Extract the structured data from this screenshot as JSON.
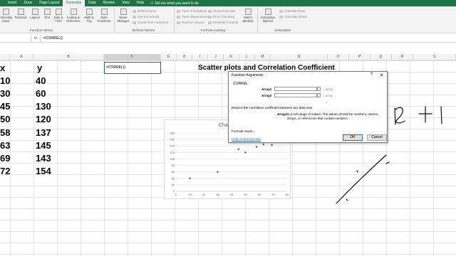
{
  "ribbon": {
    "tabs": [
      "Insert",
      "Draw",
      "Page Layout",
      "Formulas",
      "Data",
      "Review",
      "View",
      "Help"
    ],
    "active_tab": "Formulas",
    "tell_me": "Tell me what you want to do",
    "buttons": {
      "recently_used": "Recently Used",
      "financial": "Financial",
      "logical": "Logical",
      "text": "Text",
      "date_time": "Date & Time",
      "lookup_reference": "Lookup & Reference",
      "math_trig": "Math & Trig",
      "more_functions": "More Functions",
      "name_manager": "Name Manager",
      "define_name": "Define Name",
      "use_in_formula": "Use in Formula",
      "create_from_selection": "Create from Selection",
      "trace_precedents": "Trace Precedents",
      "trace_dependents": "Trace Dependents",
      "remove_arrows": "Remove Arrows",
      "show_formulas": "Show Formulas",
      "error_checking": "Error Checking",
      "evaluate_formula": "Evaluate Formula",
      "watch_window": "Watch Window",
      "calculation_options": "Calculation Options",
      "calculate_now": "Calculate Now",
      "calculate_sheet": "Calculate Sheet"
    },
    "groups": {
      "function_library": "Function Library",
      "defined_names": "Defined Names",
      "formula_auditing": "Formula Auditing",
      "calculation": "Calculation"
    }
  },
  "formula_bar": {
    "fx": "fx",
    "content": "=CORREL()"
  },
  "columns": [
    "A",
    "B",
    "C",
    "D",
    "E",
    "F",
    "G",
    "H",
    "I",
    "J",
    "K",
    "L",
    "M",
    "N",
    "O",
    "P",
    "Q",
    "R",
    "S"
  ],
  "selected_column": "F",
  "data": {
    "x_header": "x",
    "y_header": "y",
    "x_values": [
      "10",
      "30",
      "45",
      "50",
      "58",
      "63",
      "69",
      "72"
    ],
    "y_values": [
      "40",
      "60",
      "130",
      "120",
      "137",
      "145",
      "143",
      "154"
    ]
  },
  "active_cell": "=CORREL()",
  "sheet_title": "Scatter plots and Correlation Coefficient",
  "chart_data": {
    "type": "scatter",
    "title": "Chart",
    "x": [
      10,
      30,
      45,
      50,
      58,
      63,
      69
    ],
    "y": [
      40,
      60,
      130,
      120,
      137,
      145,
      143
    ],
    "xlim": [
      0,
      80
    ],
    "ylim": [
      0,
      180
    ],
    "x_ticks": [
      "0",
      "10",
      "20",
      "30",
      "40",
      "50",
      "60",
      "70",
      "80"
    ],
    "y_ticks": [
      "0",
      "20",
      "40",
      "60",
      "80",
      "100",
      "120",
      "140",
      "160",
      "180"
    ],
    "grid": true,
    "marker_color": "#4472c4"
  },
  "dialog": {
    "title": "Function Arguments",
    "help": "?",
    "close": "×",
    "function_name": "CORREL",
    "arg1_label": "Array1",
    "arg2_label": "Array2",
    "arg_result": "= array",
    "arg_equals": "=",
    "description": "Returns the correlation coefficient between two data sets.",
    "arg_name": "Array1",
    "arg_description": "is a cell range of values. The values should be numbers, names, arrays, or references that contain numbers.",
    "formula_result": "Formula result =",
    "help_link": "Help on this function",
    "ok": "OK",
    "cancel": "Cancel"
  },
  "colors": {
    "accent": "#217346",
    "link": "#2b6cb0"
  }
}
